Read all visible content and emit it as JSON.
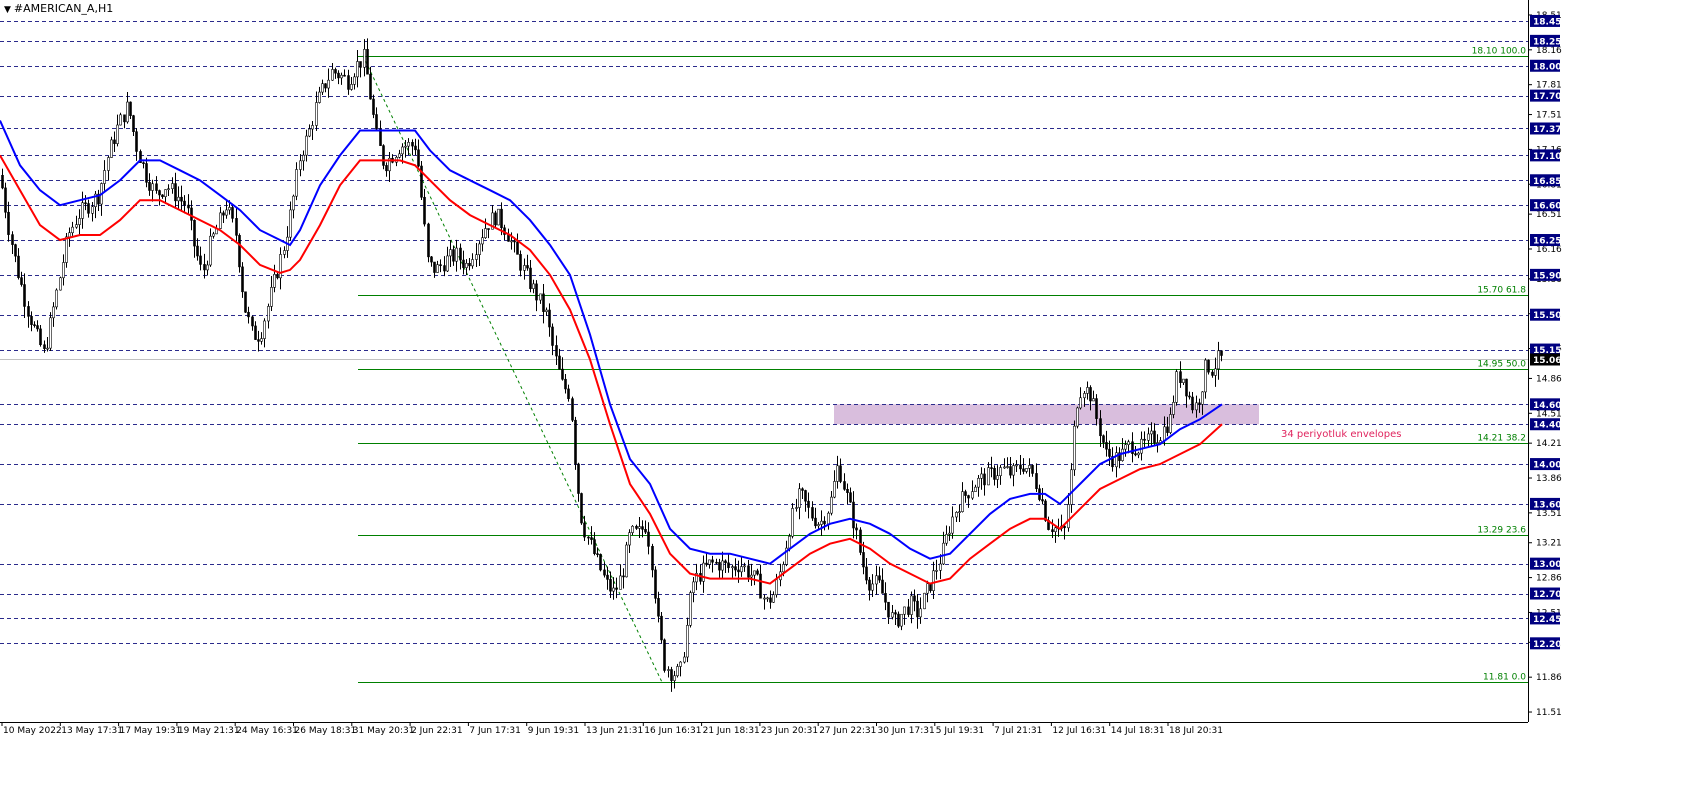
{
  "window": {
    "title": "#AMERICAN_A,H1"
  },
  "colors": {
    "background": "#ffffff",
    "grid_dash": "#2b2b8c",
    "fib": "#008000",
    "envelope_upper": "#0000ff",
    "envelope_lower": "#ff0000",
    "zone": "#d9bedd",
    "annotation": "#e0245e",
    "price_tag_bg": "#000080",
    "current_price_bg": "#000000"
  },
  "chart_data": {
    "type": "candlestick",
    "symbol": "#AMERICAN_A",
    "timeframe": "H1",
    "ylim": [
      11.45,
      18.58
    ],
    "price_scale_ticks": [
      "18.51",
      "18.16",
      "17.81",
      "17.51",
      "17.16",
      "16.81",
      "16.51",
      "16.16",
      "15.86",
      "15.51",
      "15.16",
      "14.86",
      "14.51",
      "14.21",
      "13.86",
      "13.51",
      "13.21",
      "12.86",
      "12.51",
      "12.21",
      "11.86",
      "11.51"
    ],
    "dashed_levels": [
      "18.45",
      "18.25",
      "18.00",
      "17.70",
      "17.37",
      "17.10",
      "16.85",
      "16.60",
      "16.25",
      "15.90",
      "15.50",
      "15.15",
      "14.60",
      "14.40",
      "14.00",
      "13.60",
      "13.00",
      "12.70",
      "12.45",
      "12.20"
    ],
    "current_price": "15.06",
    "fibonacci": {
      "swing_high": 18.1,
      "swing_low": 11.81,
      "levels": [
        {
          "price": 18.1,
          "label": "18.10 100.0"
        },
        {
          "price": 15.7,
          "label": "15.70 61.8"
        },
        {
          "price": 14.95,
          "label": "14.95 50.0"
        },
        {
          "price": 14.21,
          "label": "14.21 38.2"
        },
        {
          "price": 13.29,
          "label": "13.29 23.6"
        },
        {
          "price": 11.81,
          "label": "11.81 0.0"
        }
      ]
    },
    "zone": {
      "from": 14.4,
      "to": 14.6
    },
    "annotation": "34 periyotluk envelopes",
    "x_labels": [
      "10 May 2022",
      "13 May 17:31",
      "17 May 19:31",
      "19 May 21:31",
      "24 May 16:31",
      "26 May 18:31",
      "31 May 20:31",
      "2 Jun 22:31",
      "7 Jun 17:31",
      "9 Jun 19:31",
      "13 Jun 21:31",
      "16 Jun 16:31",
      "21 Jun 18:31",
      "23 Jun 20:31",
      "27 Jun 22:31",
      "30 Jun 17:31",
      "5 Jul 19:31",
      "7 Jul 21:31",
      "12 Jul 16:31",
      "14 Jul 18:31",
      "18 Jul 20:31"
    ],
    "price_path": [
      [
        0,
        16.9
      ],
      [
        8,
        16.4
      ],
      [
        16,
        16.0
      ],
      [
        26,
        15.6
      ],
      [
        36,
        15.3
      ],
      [
        44,
        15.1
      ],
      [
        52,
        15.5
      ],
      [
        60,
        15.9
      ],
      [
        68,
        16.3
      ],
      [
        78,
        16.5
      ],
      [
        88,
        16.6
      ],
      [
        98,
        16.7
      ],
      [
        108,
        17.1
      ],
      [
        118,
        17.4
      ],
      [
        128,
        17.6
      ],
      [
        136,
        17.2
      ],
      [
        146,
        16.9
      ],
      [
        156,
        16.7
      ],
      [
        166,
        16.8
      ],
      [
        176,
        16.7
      ],
      [
        186,
        16.6
      ],
      [
        194,
        16.2
      ],
      [
        202,
        15.9
      ],
      [
        210,
        16.2
      ],
      [
        218,
        16.4
      ],
      [
        226,
        16.6
      ],
      [
        236,
        16.3
      ],
      [
        244,
        15.6
      ],
      [
        252,
        15.3
      ],
      [
        260,
        15.3
      ],
      [
        268,
        15.6
      ],
      [
        276,
        15.9
      ],
      [
        284,
        16.2
      ],
      [
        292,
        16.6
      ],
      [
        300,
        17.1
      ],
      [
        308,
        17.3
      ],
      [
        316,
        17.6
      ],
      [
        324,
        17.8
      ],
      [
        332,
        17.95
      ],
      [
        340,
        17.9
      ],
      [
        348,
        17.85
      ],
      [
        356,
        18.0
      ],
      [
        364,
        18.08
      ],
      [
        370,
        17.7
      ],
      [
        376,
        17.3
      ],
      [
        384,
        17.0
      ],
      [
        392,
        17.1
      ],
      [
        400,
        17.2
      ],
      [
        408,
        17.2
      ],
      [
        416,
        17.2
      ],
      [
        422,
        16.6
      ],
      [
        428,
        16.0
      ],
      [
        436,
        15.95
      ],
      [
        446,
        16.05
      ],
      [
        456,
        16.1
      ],
      [
        466,
        16.0
      ],
      [
        476,
        16.2
      ],
      [
        486,
        16.4
      ],
      [
        496,
        16.5
      ],
      [
        506,
        16.35
      ],
      [
        516,
        16.1
      ],
      [
        526,
        15.9
      ],
      [
        536,
        15.7
      ],
      [
        546,
        15.5
      ],
      [
        554,
        15.1
      ],
      [
        562,
        14.8
      ],
      [
        570,
        14.7
      ],
      [
        576,
        13.9
      ],
      [
        582,
        13.4
      ],
      [
        590,
        13.2
      ],
      [
        598,
        13.0
      ],
      [
        606,
        12.8
      ],
      [
        614,
        12.7
      ],
      [
        622,
        12.9
      ],
      [
        630,
        13.3
      ],
      [
        638,
        13.3
      ],
      [
        646,
        13.4
      ],
      [
        652,
        13.0
      ],
      [
        658,
        12.4
      ],
      [
        664,
        12.0
      ],
      [
        672,
        11.9
      ],
      [
        680,
        11.9
      ],
      [
        686,
        12.3
      ],
      [
        692,
        12.8
      ],
      [
        700,
        12.9
      ],
      [
        710,
        13.0
      ],
      [
        720,
        13.0
      ],
      [
        730,
        12.95
      ],
      [
        740,
        13.0
      ],
      [
        750,
        12.9
      ],
      [
        758,
        12.8
      ],
      [
        766,
        12.6
      ],
      [
        774,
        12.7
      ],
      [
        782,
        13.0
      ],
      [
        790,
        13.4
      ],
      [
        800,
        13.7
      ],
      [
        810,
        13.5
      ],
      [
        820,
        13.4
      ],
      [
        830,
        13.6
      ],
      [
        838,
        14.0
      ],
      [
        846,
        13.7
      ],
      [
        854,
        13.4
      ],
      [
        862,
        13.0
      ],
      [
        870,
        12.8
      ],
      [
        878,
        12.8
      ],
      [
        886,
        12.6
      ],
      [
        894,
        12.4
      ],
      [
        902,
        12.5
      ],
      [
        910,
        12.6
      ],
      [
        918,
        12.5
      ],
      [
        926,
        12.7
      ],
      [
        934,
        12.9
      ],
      [
        942,
        13.1
      ],
      [
        950,
        13.4
      ],
      [
        958,
        13.6
      ],
      [
        966,
        13.7
      ],
      [
        974,
        13.8
      ],
      [
        982,
        13.85
      ],
      [
        992,
        13.9
      ],
      [
        1002,
        13.95
      ],
      [
        1012,
        13.9
      ],
      [
        1022,
        14.0
      ],
      [
        1032,
        13.9
      ],
      [
        1040,
        13.7
      ],
      [
        1048,
        13.4
      ],
      [
        1056,
        13.35
      ],
      [
        1064,
        13.3
      ],
      [
        1070,
        13.8
      ],
      [
        1076,
        14.6
      ],
      [
        1082,
        14.8
      ],
      [
        1090,
        14.7
      ],
      [
        1098,
        14.4
      ],
      [
        1106,
        14.1
      ],
      [
        1114,
        14.05
      ],
      [
        1122,
        14.1
      ],
      [
        1130,
        14.2
      ],
      [
        1140,
        14.15
      ],
      [
        1150,
        14.25
      ],
      [
        1160,
        14.3
      ],
      [
        1170,
        14.45
      ],
      [
        1176,
        14.85
      ],
      [
        1182,
        14.9
      ],
      [
        1188,
        14.7
      ],
      [
        1194,
        14.55
      ],
      [
        1200,
        14.7
      ],
      [
        1206,
        15.0
      ],
      [
        1212,
        14.95
      ],
      [
        1218,
        15.05
      ],
      [
        1224,
        15.06
      ]
    ],
    "envelope_upper": [
      [
        0,
        17.45
      ],
      [
        20,
        17.0
      ],
      [
        40,
        16.75
      ],
      [
        60,
        16.6
      ],
      [
        80,
        16.65
      ],
      [
        100,
        16.7
      ],
      [
        120,
        16.85
      ],
      [
        140,
        17.05
      ],
      [
        160,
        17.05
      ],
      [
        180,
        16.95
      ],
      [
        200,
        16.85
      ],
      [
        220,
        16.7
      ],
      [
        240,
        16.55
      ],
      [
        260,
        16.35
      ],
      [
        280,
        16.25
      ],
      [
        290,
        16.2
      ],
      [
        300,
        16.35
      ],
      [
        320,
        16.8
      ],
      [
        340,
        17.1
      ],
      [
        360,
        17.35
      ],
      [
        380,
        17.35
      ],
      [
        400,
        17.35
      ],
      [
        415,
        17.35
      ],
      [
        430,
        17.15
      ],
      [
        450,
        16.95
      ],
      [
        470,
        16.85
      ],
      [
        490,
        16.75
      ],
      [
        510,
        16.65
      ],
      [
        530,
        16.45
      ],
      [
        550,
        16.2
      ],
      [
        570,
        15.9
      ],
      [
        590,
        15.3
      ],
      [
        610,
        14.6
      ],
      [
        630,
        14.05
      ],
      [
        650,
        13.8
      ],
      [
        670,
        13.35
      ],
      [
        690,
        13.15
      ],
      [
        710,
        13.1
      ],
      [
        730,
        13.1
      ],
      [
        750,
        13.05
      ],
      [
        770,
        13.0
      ],
      [
        790,
        13.15
      ],
      [
        810,
        13.3
      ],
      [
        830,
        13.4
      ],
      [
        850,
        13.45
      ],
      [
        870,
        13.4
      ],
      [
        890,
        13.3
      ],
      [
        910,
        13.15
      ],
      [
        930,
        13.05
      ],
      [
        950,
        13.1
      ],
      [
        970,
        13.3
      ],
      [
        990,
        13.5
      ],
      [
        1010,
        13.65
      ],
      [
        1030,
        13.7
      ],
      [
        1045,
        13.7
      ],
      [
        1060,
        13.6
      ],
      [
        1080,
        13.8
      ],
      [
        1100,
        14.0
      ],
      [
        1120,
        14.1
      ],
      [
        1140,
        14.15
      ],
      [
        1160,
        14.2
      ],
      [
        1180,
        14.35
      ],
      [
        1200,
        14.45
      ],
      [
        1222,
        14.6
      ]
    ],
    "envelope_lower": [
      [
        0,
        17.1
      ],
      [
        20,
        16.75
      ],
      [
        40,
        16.4
      ],
      [
        60,
        16.25
      ],
      [
        80,
        16.3
      ],
      [
        100,
        16.3
      ],
      [
        120,
        16.45
      ],
      [
        140,
        16.65
      ],
      [
        160,
        16.65
      ],
      [
        180,
        16.55
      ],
      [
        200,
        16.45
      ],
      [
        220,
        16.35
      ],
      [
        240,
        16.2
      ],
      [
        260,
        16.0
      ],
      [
        280,
        15.92
      ],
      [
        290,
        15.95
      ],
      [
        300,
        16.05
      ],
      [
        320,
        16.4
      ],
      [
        340,
        16.8
      ],
      [
        360,
        17.05
      ],
      [
        380,
        17.05
      ],
      [
        400,
        17.05
      ],
      [
        415,
        17.0
      ],
      [
        430,
        16.85
      ],
      [
        450,
        16.65
      ],
      [
        470,
        16.5
      ],
      [
        490,
        16.4
      ],
      [
        510,
        16.3
      ],
      [
        530,
        16.15
      ],
      [
        550,
        15.9
      ],
      [
        570,
        15.55
      ],
      [
        590,
        15.05
      ],
      [
        610,
        14.4
      ],
      [
        630,
        13.8
      ],
      [
        650,
        13.5
      ],
      [
        670,
        13.1
      ],
      [
        690,
        12.9
      ],
      [
        710,
        12.85
      ],
      [
        730,
        12.85
      ],
      [
        750,
        12.85
      ],
      [
        770,
        12.8
      ],
      [
        790,
        12.95
      ],
      [
        810,
        13.1
      ],
      [
        830,
        13.2
      ],
      [
        850,
        13.25
      ],
      [
        870,
        13.15
      ],
      [
        890,
        13.0
      ],
      [
        910,
        12.9
      ],
      [
        930,
        12.8
      ],
      [
        950,
        12.85
      ],
      [
        970,
        13.05
      ],
      [
        990,
        13.2
      ],
      [
        1010,
        13.35
      ],
      [
        1030,
        13.45
      ],
      [
        1045,
        13.45
      ],
      [
        1060,
        13.35
      ],
      [
        1080,
        13.55
      ],
      [
        1100,
        13.75
      ],
      [
        1120,
        13.85
      ],
      [
        1140,
        13.95
      ],
      [
        1160,
        14.0
      ],
      [
        1180,
        14.1
      ],
      [
        1200,
        14.2
      ],
      [
        1222,
        14.4
      ]
    ]
  }
}
